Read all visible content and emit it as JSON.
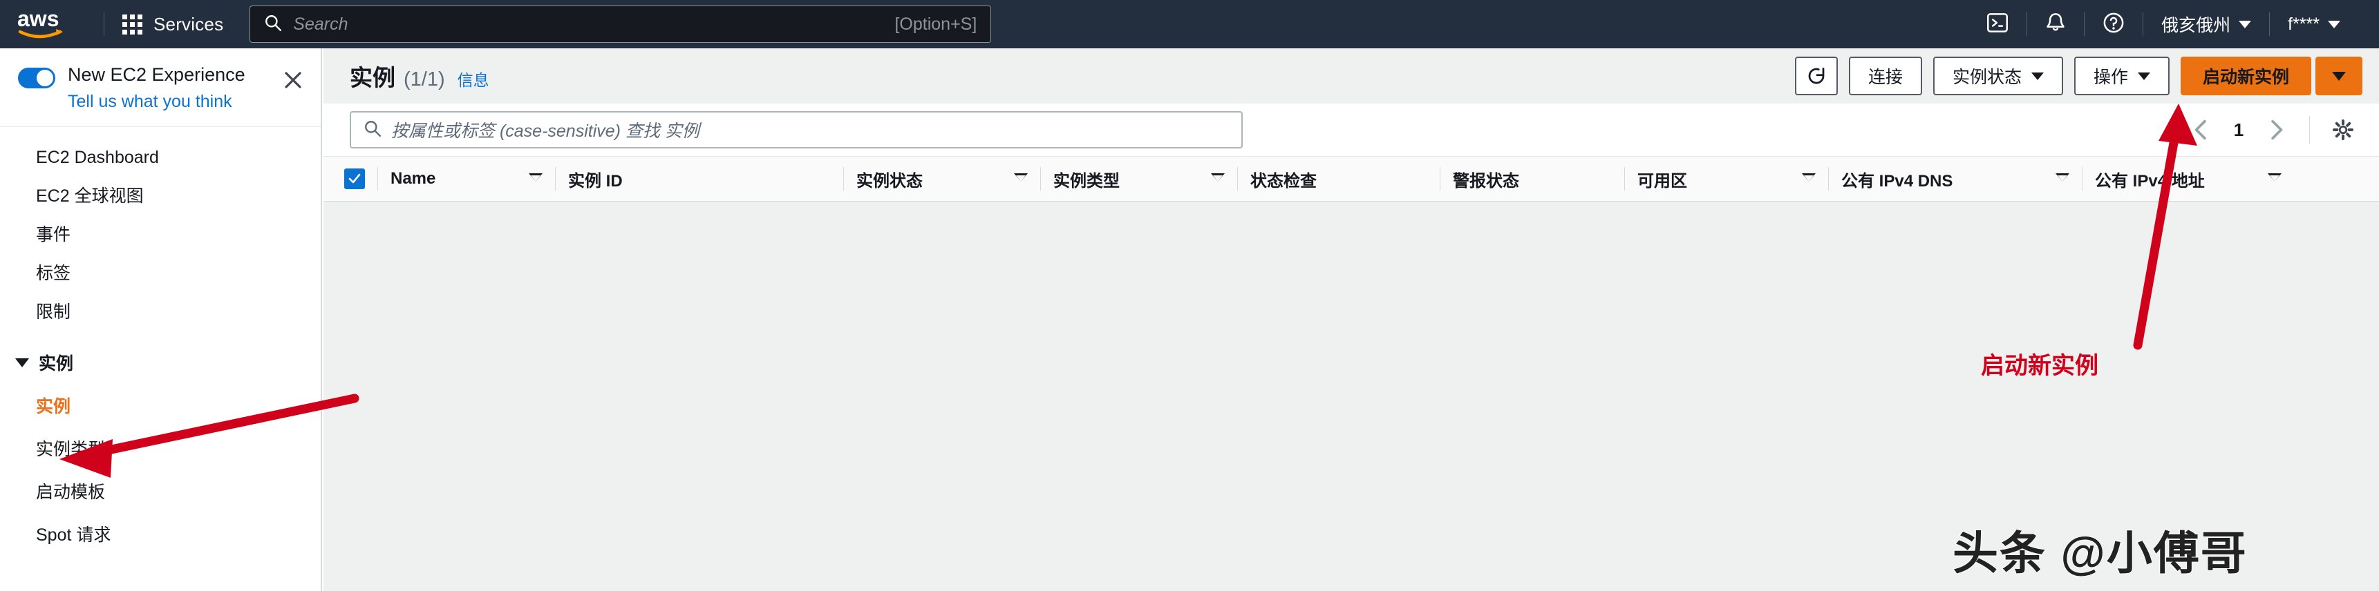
{
  "topnav": {
    "logo_alt": "aws",
    "services_label": "Services",
    "search": {
      "placeholder": "Search",
      "shortcut": "[Option+S]",
      "icon": "search-icon"
    },
    "right_items": [
      {
        "name": "cloudshell-icon",
        "type": "icon",
        "label": ""
      },
      {
        "name": "notifications-icon",
        "type": "icon",
        "label": ""
      },
      {
        "name": "help-icon",
        "type": "icon",
        "label": ""
      }
    ],
    "region": "俄亥俄州",
    "account": "f****"
  },
  "sidebar": {
    "new_experience": {
      "title": "New EC2 Experience",
      "link": "Tell us what you think",
      "toggle_on": true,
      "close_icon": "close-icon"
    },
    "items": [
      {
        "label": "EC2 Dashboard"
      },
      {
        "label": "EC2 全球视图"
      },
      {
        "label": "事件"
      },
      {
        "label": "标签"
      },
      {
        "label": "限制"
      }
    ],
    "group": {
      "label": "实例",
      "expanded": true,
      "children": [
        {
          "label": "实例",
          "active": true
        },
        {
          "label": "实例类型",
          "active": false
        },
        {
          "label": "启动模板",
          "active": false
        },
        {
          "label": "Spot 请求",
          "active": false
        }
      ]
    }
  },
  "main": {
    "header": {
      "title": "实例",
      "count": "(1/1)",
      "info_link": "信息"
    },
    "toolbar": {
      "refresh_label": "",
      "refresh_icon": "refresh-icon",
      "connect_label": "连接",
      "instance_state_label": "实例状态",
      "actions_label": "操作",
      "launch_label": "启动新实例",
      "launch_caret_label": ""
    },
    "filter": {
      "placeholder": "按属性或标签 (case-sensitive) 查找 实例",
      "icon": "search-icon"
    },
    "pagination": {
      "prev_icon": "chevron-left-icon",
      "page": "1",
      "next_icon": "chevron-right-icon",
      "settings_icon": "gear-icon"
    },
    "table": {
      "select_all_checked": true,
      "columns": [
        {
          "label": "Name",
          "sortable": true
        },
        {
          "label": "实例 ID",
          "sortable": false
        },
        {
          "label": "实例状态",
          "sortable": true
        },
        {
          "label": "实例类型",
          "sortable": true
        },
        {
          "label": "状态检查",
          "sortable": false
        },
        {
          "label": "警报状态",
          "sortable": false
        },
        {
          "label": "可用区",
          "sortable": true
        },
        {
          "label": "公有 IPv4 DNS",
          "sortable": true
        },
        {
          "label": "公有 IPv4 地址",
          "sortable": true
        }
      ],
      "rows": []
    }
  },
  "annotations": {
    "launch_callout": "启动新实例",
    "arrow_color": "#d0021b"
  },
  "watermark": {
    "text": "头条 @小傅哥"
  },
  "colors": {
    "nav_background": "#232f3e",
    "accent_orange": "#ec7211",
    "link_blue": "#0972d3",
    "active_orange": "#e8711e",
    "annotation_red": "#d0021b",
    "page_background": "#eff0f0"
  }
}
